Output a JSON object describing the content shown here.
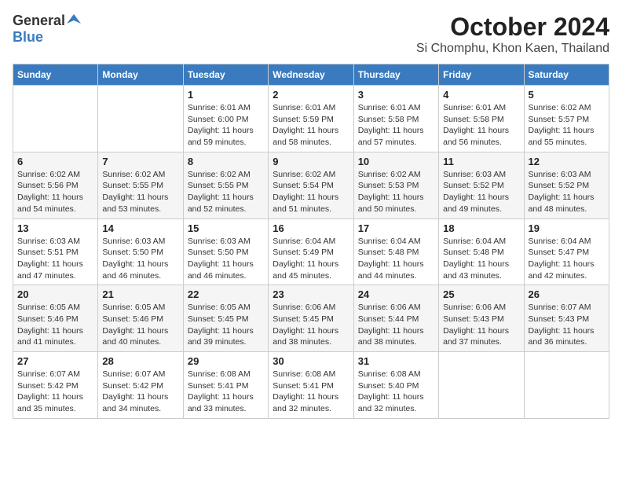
{
  "header": {
    "logo_general": "General",
    "logo_blue": "Blue",
    "month_title": "October 2024",
    "location": "Si Chomphu, Khon Kaen, Thailand"
  },
  "weekdays": [
    "Sunday",
    "Monday",
    "Tuesday",
    "Wednesday",
    "Thursday",
    "Friday",
    "Saturday"
  ],
  "weeks": [
    [
      {
        "day": "",
        "info": ""
      },
      {
        "day": "",
        "info": ""
      },
      {
        "day": "1",
        "info": "Sunrise: 6:01 AM\nSunset: 6:00 PM\nDaylight: 11 hours and 59 minutes."
      },
      {
        "day": "2",
        "info": "Sunrise: 6:01 AM\nSunset: 5:59 PM\nDaylight: 11 hours and 58 minutes."
      },
      {
        "day": "3",
        "info": "Sunrise: 6:01 AM\nSunset: 5:58 PM\nDaylight: 11 hours and 57 minutes."
      },
      {
        "day": "4",
        "info": "Sunrise: 6:01 AM\nSunset: 5:58 PM\nDaylight: 11 hours and 56 minutes."
      },
      {
        "day": "5",
        "info": "Sunrise: 6:02 AM\nSunset: 5:57 PM\nDaylight: 11 hours and 55 minutes."
      }
    ],
    [
      {
        "day": "6",
        "info": "Sunrise: 6:02 AM\nSunset: 5:56 PM\nDaylight: 11 hours and 54 minutes."
      },
      {
        "day": "7",
        "info": "Sunrise: 6:02 AM\nSunset: 5:55 PM\nDaylight: 11 hours and 53 minutes."
      },
      {
        "day": "8",
        "info": "Sunrise: 6:02 AM\nSunset: 5:55 PM\nDaylight: 11 hours and 52 minutes."
      },
      {
        "day": "9",
        "info": "Sunrise: 6:02 AM\nSunset: 5:54 PM\nDaylight: 11 hours and 51 minutes."
      },
      {
        "day": "10",
        "info": "Sunrise: 6:02 AM\nSunset: 5:53 PM\nDaylight: 11 hours and 50 minutes."
      },
      {
        "day": "11",
        "info": "Sunrise: 6:03 AM\nSunset: 5:52 PM\nDaylight: 11 hours and 49 minutes."
      },
      {
        "day": "12",
        "info": "Sunrise: 6:03 AM\nSunset: 5:52 PM\nDaylight: 11 hours and 48 minutes."
      }
    ],
    [
      {
        "day": "13",
        "info": "Sunrise: 6:03 AM\nSunset: 5:51 PM\nDaylight: 11 hours and 47 minutes."
      },
      {
        "day": "14",
        "info": "Sunrise: 6:03 AM\nSunset: 5:50 PM\nDaylight: 11 hours and 46 minutes."
      },
      {
        "day": "15",
        "info": "Sunrise: 6:03 AM\nSunset: 5:50 PM\nDaylight: 11 hours and 46 minutes."
      },
      {
        "day": "16",
        "info": "Sunrise: 6:04 AM\nSunset: 5:49 PM\nDaylight: 11 hours and 45 minutes."
      },
      {
        "day": "17",
        "info": "Sunrise: 6:04 AM\nSunset: 5:48 PM\nDaylight: 11 hours and 44 minutes."
      },
      {
        "day": "18",
        "info": "Sunrise: 6:04 AM\nSunset: 5:48 PM\nDaylight: 11 hours and 43 minutes."
      },
      {
        "day": "19",
        "info": "Sunrise: 6:04 AM\nSunset: 5:47 PM\nDaylight: 11 hours and 42 minutes."
      }
    ],
    [
      {
        "day": "20",
        "info": "Sunrise: 6:05 AM\nSunset: 5:46 PM\nDaylight: 11 hours and 41 minutes."
      },
      {
        "day": "21",
        "info": "Sunrise: 6:05 AM\nSunset: 5:46 PM\nDaylight: 11 hours and 40 minutes."
      },
      {
        "day": "22",
        "info": "Sunrise: 6:05 AM\nSunset: 5:45 PM\nDaylight: 11 hours and 39 minutes."
      },
      {
        "day": "23",
        "info": "Sunrise: 6:06 AM\nSunset: 5:45 PM\nDaylight: 11 hours and 38 minutes."
      },
      {
        "day": "24",
        "info": "Sunrise: 6:06 AM\nSunset: 5:44 PM\nDaylight: 11 hours and 38 minutes."
      },
      {
        "day": "25",
        "info": "Sunrise: 6:06 AM\nSunset: 5:43 PM\nDaylight: 11 hours and 37 minutes."
      },
      {
        "day": "26",
        "info": "Sunrise: 6:07 AM\nSunset: 5:43 PM\nDaylight: 11 hours and 36 minutes."
      }
    ],
    [
      {
        "day": "27",
        "info": "Sunrise: 6:07 AM\nSunset: 5:42 PM\nDaylight: 11 hours and 35 minutes."
      },
      {
        "day": "28",
        "info": "Sunrise: 6:07 AM\nSunset: 5:42 PM\nDaylight: 11 hours and 34 minutes."
      },
      {
        "day": "29",
        "info": "Sunrise: 6:08 AM\nSunset: 5:41 PM\nDaylight: 11 hours and 33 minutes."
      },
      {
        "day": "30",
        "info": "Sunrise: 6:08 AM\nSunset: 5:41 PM\nDaylight: 11 hours and 32 minutes."
      },
      {
        "day": "31",
        "info": "Sunrise: 6:08 AM\nSunset: 5:40 PM\nDaylight: 11 hours and 32 minutes."
      },
      {
        "day": "",
        "info": ""
      },
      {
        "day": "",
        "info": ""
      }
    ]
  ]
}
